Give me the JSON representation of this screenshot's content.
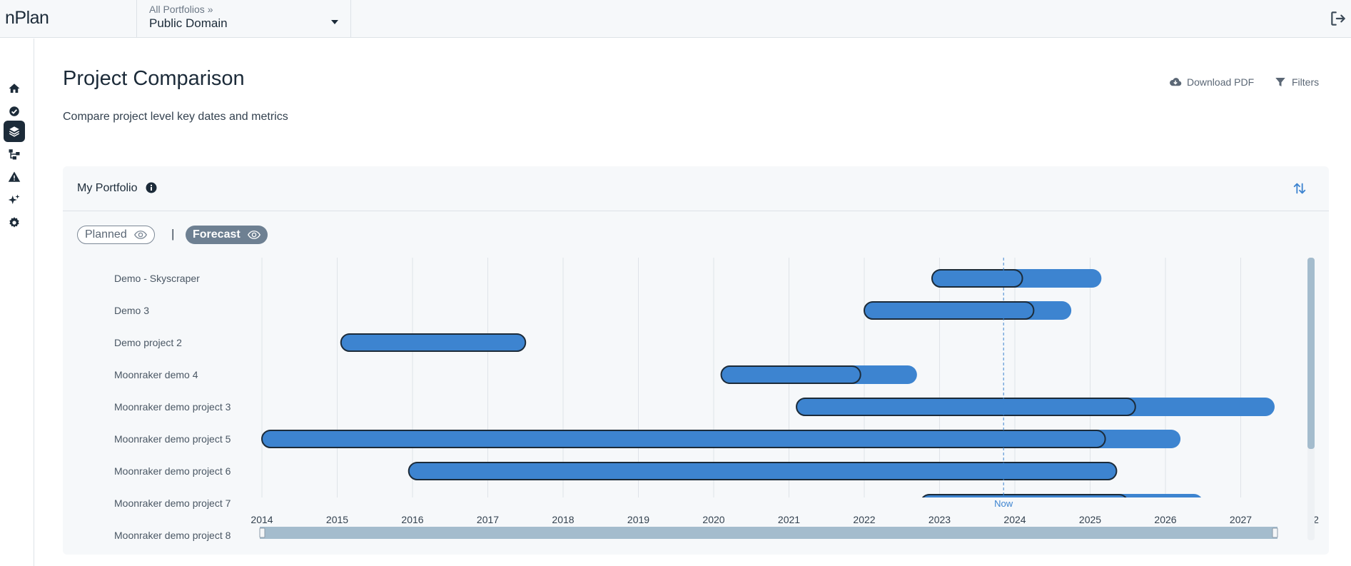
{
  "app": {
    "logo": "nPlan",
    "breadcrumb": "All Portfolios  »",
    "portfolio": "Public Domain"
  },
  "sidebar": {
    "items": [
      {
        "name": "home",
        "icon": "home-icon"
      },
      {
        "name": "check",
        "icon": "check-circle-icon"
      },
      {
        "name": "portfolio",
        "icon": "layers-icon",
        "active": true
      },
      {
        "name": "hierarchy",
        "icon": "hierarchy-icon"
      },
      {
        "name": "risks",
        "icon": "warning-icon"
      },
      {
        "name": "ai",
        "icon": "sparkle-icon"
      },
      {
        "name": "settings",
        "icon": "gear-icon"
      }
    ]
  },
  "page": {
    "title": "Project Comparison",
    "subtitle": "Compare project level key dates and metrics",
    "download_label": "Download PDF",
    "filters_label": "Filters"
  },
  "card": {
    "title": "My Portfolio",
    "planned_label": "Planned",
    "separator": "|",
    "forecast_label": "Forecast"
  },
  "colors": {
    "accent": "#3d84d0",
    "dark": "#1c2b39",
    "scrollbar": "#a4bccd",
    "pill_active": "#6e8092"
  },
  "chart_data": {
    "type": "gantt",
    "x_unit": "year",
    "xlim": [
      2014,
      2028
    ],
    "ticks": [
      "2014",
      "2015",
      "2016",
      "2017",
      "2018",
      "2019",
      "2020",
      "2021",
      "2022",
      "2023",
      "2024",
      "2025",
      "2026",
      "2027",
      "2"
    ],
    "now_label": "Now",
    "now": 2023.85,
    "projects": [
      {
        "name": "Demo - Skyscraper",
        "planned": [
          2022.9,
          2024.1
        ],
        "forecast": [
          2022.9,
          2025.15
        ]
      },
      {
        "name": "Demo 3",
        "planned": [
          2022.0,
          2024.25
        ],
        "forecast": [
          2022.0,
          2024.75
        ]
      },
      {
        "name": "Demo project 2",
        "planned": [
          2015.05,
          2017.5
        ],
        "forecast": [
          2015.05,
          2017.5
        ]
      },
      {
        "name": "Moonraker demo 4",
        "planned": [
          2020.1,
          2021.95
        ],
        "forecast": [
          2020.1,
          2022.7
        ]
      },
      {
        "name": "Moonraker demo project 3",
        "planned": [
          2021.1,
          2025.6
        ],
        "forecast": [
          2021.1,
          2027.45
        ]
      },
      {
        "name": "Moonraker demo project 5",
        "planned": [
          2014.0,
          2025.2
        ],
        "forecast": [
          2014.0,
          2026.2
        ]
      },
      {
        "name": "Moonraker demo project 6",
        "planned": [
          2015.95,
          2025.35
        ],
        "forecast": [
          2015.95,
          2025.35
        ]
      },
      {
        "name": "Moonraker demo project 7",
        "planned": [
          2022.75,
          2025.5
        ],
        "forecast": [
          2022.75,
          2026.5
        ]
      },
      {
        "name": "Moonraker demo project 8",
        "planned": null,
        "forecast": null
      }
    ]
  }
}
